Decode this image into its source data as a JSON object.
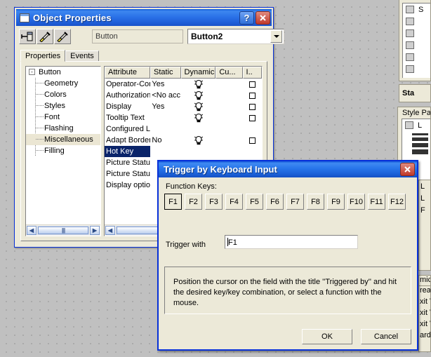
{
  "object_properties": {
    "title": "Object Properties",
    "window_icon": "window-icon",
    "help_button": "?",
    "close_button": "✕",
    "toolbar": {
      "pin_icon": "pin-icon",
      "pick_style_icon": "eyedropper-style-icon",
      "apply_style_icon": "eyedropper-apply-icon"
    },
    "object_type": "Button",
    "object_name": "Button2",
    "tabs": [
      {
        "label": "Properties",
        "active": true
      },
      {
        "label": "Events",
        "active": false
      }
    ],
    "tree": {
      "root": "Button",
      "expander": "-",
      "children": [
        {
          "label": "Geometry",
          "selected": false
        },
        {
          "label": "Colors",
          "selected": false
        },
        {
          "label": "Styles",
          "selected": false
        },
        {
          "label": "Font",
          "selected": false
        },
        {
          "label": "Flashing",
          "selected": false
        },
        {
          "label": "Miscellaneous",
          "selected": true
        },
        {
          "label": "Filling",
          "selected": false
        }
      ]
    },
    "table": {
      "columns": [
        "Attribute",
        "Static",
        "Dynamic",
        "Cu...",
        "I.."
      ],
      "rows": [
        {
          "attribute": "Operator-Con",
          "static": "Yes",
          "dynamic": "lightbulb-icon",
          "current": "",
          "indirect": "checkbox",
          "selected": false
        },
        {
          "attribute": "Authorization",
          "static": "<No acc",
          "dynamic": "lightbulb-icon",
          "current": "",
          "indirect": "checkbox",
          "selected": false
        },
        {
          "attribute": "Display",
          "static": "Yes",
          "dynamic": "lightbulb-icon",
          "current": "",
          "indirect": "checkbox",
          "selected": false
        },
        {
          "attribute": "Tooltip Text",
          "static": "",
          "dynamic": "lightbulb-icon",
          "current": "",
          "indirect": "checkbox",
          "selected": false
        },
        {
          "attribute": "Configured La",
          "static": "",
          "dynamic": "",
          "current": "",
          "indirect": "",
          "selected": false
        },
        {
          "attribute": "Adapt Border",
          "static": "No",
          "dynamic": "lightbulb-icon",
          "current": "",
          "indirect": "checkbox",
          "selected": false
        },
        {
          "attribute": "Hot Key",
          "static": "",
          "dynamic": "",
          "current": "",
          "indirect": "",
          "selected": true
        },
        {
          "attribute": "Picture Status",
          "static": "",
          "dynamic": "",
          "current": "",
          "indirect": "",
          "selected": false
        },
        {
          "attribute": "Picture Status",
          "static": "",
          "dynamic": "",
          "current": "",
          "indirect": "",
          "selected": false
        },
        {
          "attribute": "Display option",
          "static": "",
          "dynamic": "",
          "current": "",
          "indirect": "",
          "selected": false
        }
      ]
    },
    "scrollbars": {
      "left_arrow": "◀",
      "right_arrow": "▶",
      "grip": "||||"
    }
  },
  "trigger_dialog": {
    "title": "Trigger by Keyboard Input",
    "close_button": "✕",
    "function_keys_label": "Function Keys:",
    "function_keys": [
      "F1",
      "F2",
      "F3",
      "F4",
      "F5",
      "F6",
      "F7",
      "F8",
      "F9",
      "F10",
      "F11",
      "F12"
    ],
    "pressed_key": "F1",
    "trigger_with_label": "Trigger with",
    "trigger_with_value": "F1",
    "info_text": "Position the cursor on the field with the title ''Triggered by'' and hit the desired key/key combination, or select a function with the mouse.",
    "ok_label": "OK",
    "cancel_label": "Cancel"
  },
  "right_panels": {
    "object_palette_items": [
      "S",
      "",
      "",
      "",
      "",
      "",
      "",
      "",
      ""
    ],
    "status_label": "Sta",
    "style_palette_title": "Style Pale",
    "style_palette_root": "L",
    "tree_items": [
      "L",
      "L",
      "F"
    ],
    "dynamic_header": "mic",
    "dynamic_items": [
      "reat",
      "xit V",
      "xit V",
      "xit V",
      "ardc"
    ]
  },
  "colors": {
    "titlebar_blue": "#1f5fd9",
    "dialog_border": "#0831d9",
    "face": "#ece9d8",
    "selection": "#0a246a",
    "tree_selection": "#ebe6d3",
    "desktop": "#c0c0c0"
  }
}
